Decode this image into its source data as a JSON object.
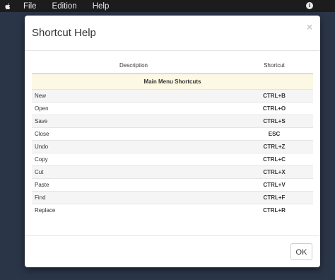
{
  "menubar": {
    "icon": "apple-icon",
    "items": [
      "File",
      "Edition",
      "Help"
    ],
    "info_icon": "info-icon",
    "info_glyph": "i"
  },
  "modal": {
    "title": "Shortcut Help",
    "close_glyph": "×",
    "columns": {
      "description": "Description",
      "shortcut": "Shortcut"
    },
    "section": "Main Menu Shortcuts",
    "rows": [
      {
        "description": "New",
        "shortcut": "CTRL+B"
      },
      {
        "description": "Open",
        "shortcut": "CTRL+O"
      },
      {
        "description": "Save",
        "shortcut": "CTRL+S"
      },
      {
        "description": "Close",
        "shortcut": "ESC"
      },
      {
        "description": "Undo",
        "shortcut": "CTRL+Z"
      },
      {
        "description": "Copy",
        "shortcut": "CTRL+C"
      },
      {
        "description": "Cut",
        "shortcut": "CTRL+X"
      },
      {
        "description": "Paste",
        "shortcut": "CTRL+V"
      },
      {
        "description": "Find",
        "shortcut": "CTRL+F"
      },
      {
        "description": "Replace",
        "shortcut": "CTRL+R"
      }
    ],
    "ok_label": "OK"
  },
  "colors": {
    "desktop": "#2b3548",
    "menubar": "#1c1c1c",
    "section_highlight": "#fcf8e3"
  }
}
